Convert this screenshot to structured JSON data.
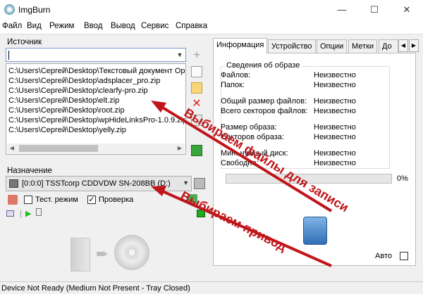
{
  "window": {
    "title": "ImgBurn",
    "minimize": "—",
    "maximize": "☐",
    "close": "✕"
  },
  "menu": [
    "Файл",
    "Вид",
    "Режим",
    "Ввод",
    "Вывод",
    "Сервис",
    "Справка"
  ],
  "source": {
    "label": "Источник",
    "input_value": "",
    "files": [
      "C:\\Users\\Сергей\\Desktop\\Текстовый документ Op",
      "C:\\Users\\Сергей\\Desktop\\adsplacer_pro.zip",
      "C:\\Users\\Сергей\\Desktop\\clearfy-pro.zip",
      "C:\\Users\\Сергей\\Desktop\\elt.zip",
      "C:\\Users\\Сергей\\Desktop\\root.zip",
      "C:\\Users\\Сергей\\Desktop\\wpHideLinksPro-1.0.9.zip",
      "C:\\Users\\Сергей\\Desktop\\yelly.zip"
    ]
  },
  "destination": {
    "label": "Назначение",
    "drive": "[0:0:0] TSSTcorp CDDVDW SN-208BB (D:)",
    "test_mode_label": "Тест. режим",
    "test_mode_checked": false,
    "verify_label": "Проверка",
    "verify_checked": true,
    "verify_mark": "✓"
  },
  "tabs": [
    "Информация",
    "Устройство",
    "Опции",
    "Метки",
    "До"
  ],
  "info": {
    "group_title": "Сведения об образе",
    "rows": [
      {
        "label": "Файлов:",
        "value": "Неизвестно"
      },
      {
        "label": "Папок:",
        "value": "Неизвестно"
      },
      {
        "label": "Общий размер файлов:",
        "value": "Неизвестно"
      },
      {
        "label": "Всего секторов файлов:",
        "value": "Неизвестно"
      },
      {
        "label": "Размер образа:",
        "value": "Неизвестно"
      },
      {
        "label": "Секторов образа:",
        "value": "Неизвестно"
      },
      {
        "label": "Мин. нужный диск:",
        "value": "Неизвестно"
      },
      {
        "label": "Свободно:",
        "value": "Неизвестно"
      }
    ],
    "progress_text": "0%",
    "progress": 0,
    "auto_label": "Авто",
    "auto_checked": false
  },
  "status": "Device Not Ready (Medium Not Present - Tray Closed)",
  "annotations": {
    "files": "Выбираем файлы для записи",
    "drive": "Выбираем привод"
  },
  "colors": {
    "accent_red": "#c0161b",
    "focus_blue": "#7a9cd3"
  }
}
